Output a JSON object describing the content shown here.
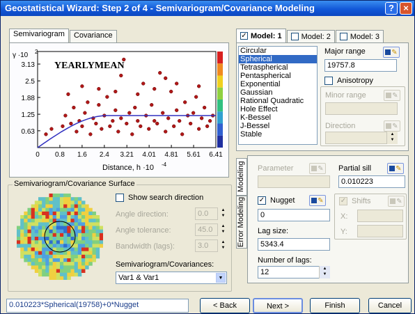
{
  "window": {
    "title": "Geostatistical Wizard: Step 2 of 4 - Semivariogram/Covariance Modeling",
    "help": "?",
    "close": "×"
  },
  "left_tabs": [
    "Semivariogram",
    "Covariance"
  ],
  "chart_data": {
    "type": "scatter",
    "title": "YEARLYMEAN",
    "ylabel": "γ ·10",
    "ylabel_exp": "2",
    "xlabel": "Distance, h ·10",
    "xlabel_exp": "-4",
    "x_ticks": [
      "0",
      "0.8",
      "1.6",
      "2.4",
      "3.21",
      "4.01",
      "4.81",
      "5.61",
      "6.41"
    ],
    "y_ticks": [
      "0.63",
      "1.25",
      "1.88",
      "2.5",
      "3.13"
    ],
    "xlim": [
      0,
      6.41
    ],
    "ylim": [
      0,
      3.6
    ],
    "series": [
      {
        "values": [
          [
            0.3,
            0.5
          ],
          [
            0.5,
            0.7
          ],
          [
            0.9,
            0.8
          ],
          [
            1.0,
            1.2
          ],
          [
            1.1,
            2.0
          ],
          [
            1.2,
            0.9
          ],
          [
            1.3,
            1.5
          ],
          [
            1.4,
            0.6
          ],
          [
            1.5,
            1.0
          ],
          [
            1.6,
            0.8
          ],
          [
            1.7,
            1.3
          ],
          [
            1.8,
            1.7
          ],
          [
            1.9,
            0.5
          ],
          [
            2.0,
            1.1
          ],
          [
            2.1,
            0.9
          ],
          [
            2.2,
            1.6
          ],
          [
            2.3,
            0.7
          ],
          [
            2.4,
            1.2
          ],
          [
            2.5,
            1.9
          ],
          [
            2.6,
            0.8
          ],
          [
            2.7,
            1.0
          ],
          [
            2.8,
            1.4
          ],
          [
            2.9,
            0.6
          ],
          [
            3.0,
            1.1
          ],
          [
            3.1,
            3.3
          ],
          [
            3.2,
            0.9
          ],
          [
            3.3,
            1.3
          ],
          [
            3.4,
            0.5
          ],
          [
            3.5,
            1.5
          ],
          [
            3.6,
            1.0
          ],
          [
            3.7,
            0.8
          ],
          [
            3.8,
            2.4
          ],
          [
            3.9,
            1.2
          ],
          [
            4.0,
            0.7
          ],
          [
            4.1,
            1.6
          ],
          [
            4.2,
            1.0
          ],
          [
            4.3,
            0.9
          ],
          [
            4.4,
            2.8
          ],
          [
            4.5,
            1.3
          ],
          [
            4.6,
            0.6
          ],
          [
            4.7,
            1.1
          ],
          [
            4.8,
            2.1
          ],
          [
            4.9,
            0.8
          ],
          [
            5.0,
            1.4
          ],
          [
            5.1,
            1.0
          ],
          [
            5.2,
            0.5
          ],
          [
            5.3,
            1.7
          ],
          [
            5.4,
            1.2
          ],
          [
            5.5,
            0.9
          ],
          [
            5.6,
            1.3
          ],
          [
            5.7,
            1.9
          ],
          [
            5.8,
            0.7
          ],
          [
            5.9,
            1.1
          ],
          [
            6.0,
            1.5
          ],
          [
            6.1,
            0.8
          ],
          [
            6.2,
            1.0
          ],
          [
            6.3,
            1.2
          ],
          [
            3.0,
            2.7
          ],
          [
            2.2,
            2.2
          ],
          [
            4.6,
            2.6
          ],
          [
            1.6,
            2.3
          ],
          [
            5.0,
            2.4
          ],
          [
            3.6,
            2.0
          ],
          [
            2.8,
            2.1
          ],
          [
            4.2,
            2.2
          ],
          [
            5.8,
            2.3
          ]
        ]
      }
    ],
    "model_curve": "spherical",
    "legend_colors": [
      "#d82020",
      "#f08a20",
      "#f0d020",
      "#90d040",
      "#30c080",
      "#30a0d0",
      "#3060d0",
      "#2030a0"
    ]
  },
  "surface": {
    "title": "Semivariogram/Covariance Surface",
    "show_search": "Show search direction",
    "angle_dir_label": "Angle direction:",
    "angle_dir": "0.0",
    "angle_tol_label": "Angle tolerance:",
    "angle_tol": "45.0",
    "bandwidth_label": "Bandwidth (lags):",
    "bandwidth": "3.0",
    "select_label": "Semivariogram/Covariances:",
    "select_value": "Var1 & Var1"
  },
  "models": {
    "tabs": [
      "Model: 1",
      "Model: 2",
      "Model: 3"
    ],
    "types": [
      "Circular",
      "Spherical",
      "Tetraspherical",
      "Pentaspherical",
      "Exponential",
      "Gaussian",
      "Rational Quadratic",
      "Hole Effect",
      "K-Bessel",
      "J-Bessel",
      "Stable"
    ],
    "selected": "Spherical",
    "major_range_label": "Major range",
    "major_range": "19757.8",
    "anisotropy_label": "Anisotropy",
    "minor_range_label": "Minor range",
    "direction_label": "Direction"
  },
  "lower_right": {
    "vtabs": [
      "Modeling",
      "Error Modeling"
    ],
    "parameter_label": "Parameter",
    "partial_sill_label": "Partial sill",
    "partial_sill": "0.010223",
    "nugget_label": "Nugget",
    "nugget": "0",
    "shifts_label": "Shifts",
    "x_label": "X:",
    "y_label": "Y:",
    "lag_size_label": "Lag size:",
    "lag_size": "5343.4",
    "num_lags_label": "Number of lags:",
    "num_lags": "12"
  },
  "footer": {
    "formula": "0.010223*Spherical(19758)+0*Nugget",
    "back": "< Back",
    "next": "Next >",
    "finish": "Finish",
    "cancel": "Cancel"
  }
}
